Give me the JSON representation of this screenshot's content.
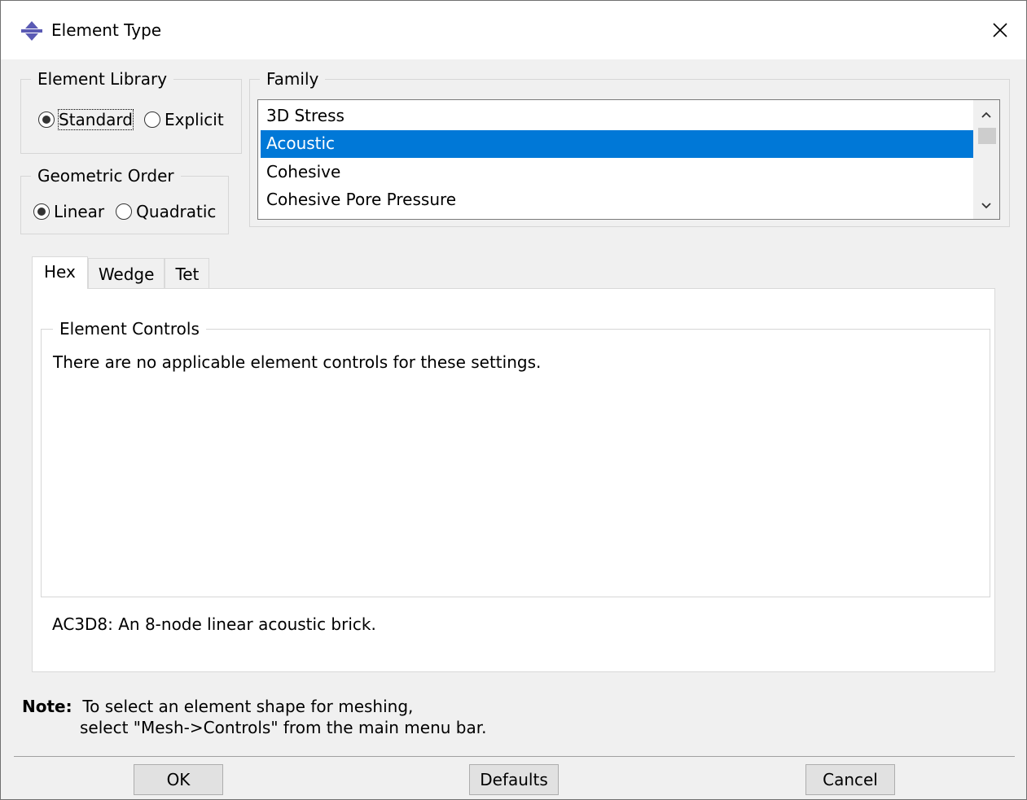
{
  "window": {
    "title": "Element Type",
    "close_glyph": "✕"
  },
  "element_library": {
    "legend": "Element Library",
    "options": [
      "Standard",
      "Explicit"
    ],
    "selected": "Standard"
  },
  "geometric_order": {
    "legend": "Geometric Order",
    "options": [
      "Linear",
      "Quadratic"
    ],
    "selected": "Linear"
  },
  "family": {
    "legend": "Family",
    "items": [
      "3D Stress",
      "Acoustic",
      "Cohesive",
      "Cohesive Pore Pressure"
    ],
    "selected": "Acoustic"
  },
  "tabs": {
    "items": [
      "Hex",
      "Wedge",
      "Tet"
    ],
    "active": "Hex"
  },
  "element_controls": {
    "legend": "Element Controls",
    "message": "There are no applicable element controls for these settings."
  },
  "element_description": "AC3D8:  An 8-node linear acoustic brick.",
  "note": {
    "label": "Note:",
    "line1": "To select an element shape for meshing,",
    "line2": "select \"Mesh->Controls\" from the main menu bar."
  },
  "buttons": {
    "ok": "OK",
    "defaults": "Defaults",
    "cancel": "Cancel"
  },
  "colors": {
    "selection": "#0078d7",
    "dialog_bg": "#f0f0f0",
    "title_icon": "#5a5ab4"
  }
}
